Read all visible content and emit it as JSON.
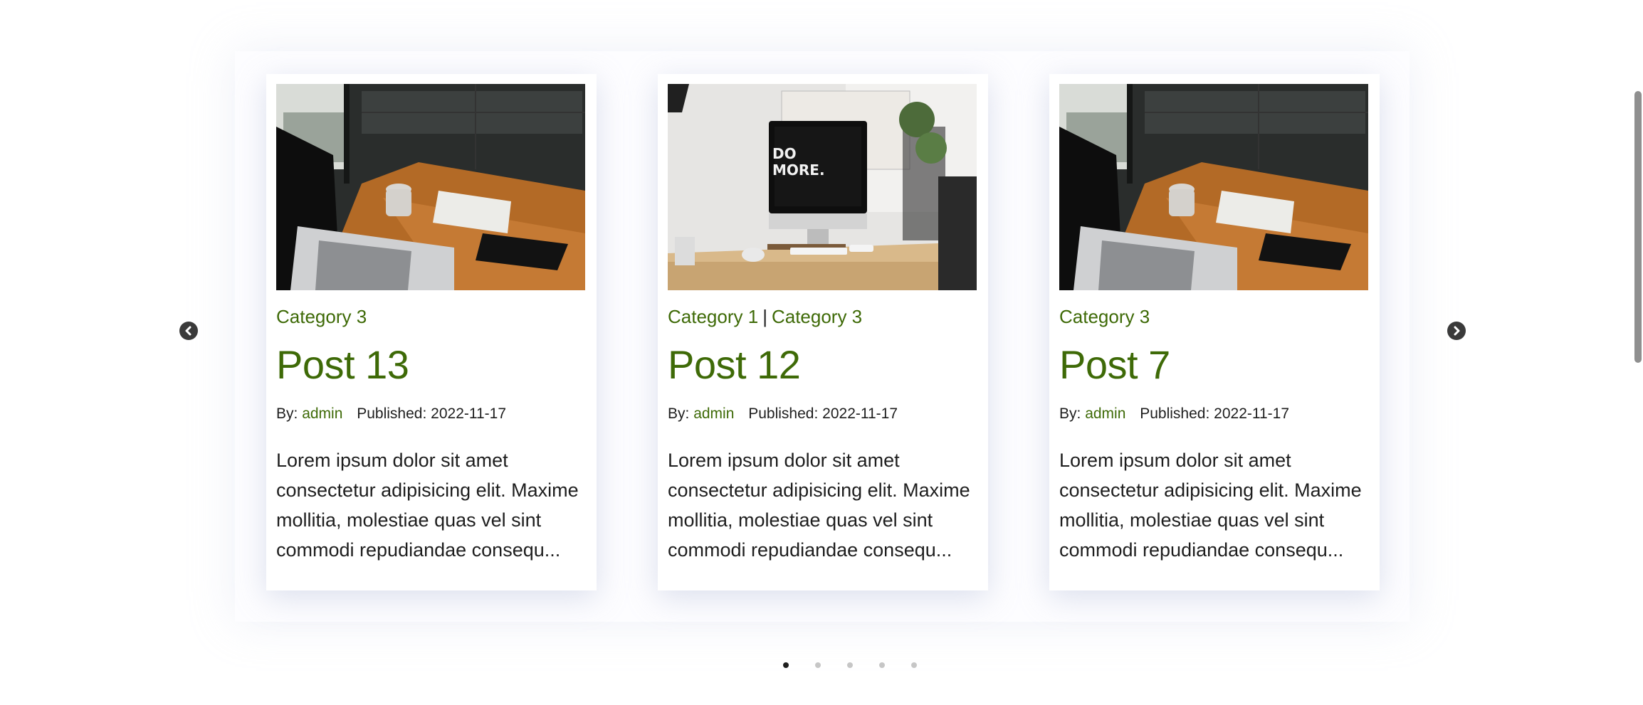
{
  "carousel": {
    "prev_icon": "chevron-left-circle-icon",
    "next_icon": "chevron-right-circle-icon",
    "posts": [
      {
        "image": "laptop-desk-photo",
        "categories": [
          "Category 3"
        ],
        "title": "Post 13",
        "by_label": "By:",
        "author": "admin",
        "published_label": "Published:",
        "published": "2022-11-17",
        "excerpt": "Lorem ipsum dolor sit amet consectetur adipisicing elit. Maxime mollitia, molestiae quas vel sint commodi repudiandae consequ..."
      },
      {
        "image": "imac-desk-photo",
        "image_text": "DO MORE.",
        "categories": [
          "Category 1",
          "Category 3"
        ],
        "category_separator": "|",
        "title": "Post 12",
        "by_label": "By:",
        "author": "admin",
        "published_label": "Published:",
        "published": "2022-11-17",
        "excerpt": "Lorem ipsum dolor sit amet consectetur adipisicing elit. Maxime mollitia, molestiae quas vel sint commodi repudiandae consequ..."
      },
      {
        "image": "laptop-desk-photo",
        "categories": [
          "Category 3"
        ],
        "title": "Post 7",
        "by_label": "By:",
        "author": "admin",
        "published_label": "Published:",
        "published": "2022-11-17",
        "excerpt": "Lorem ipsum dolor sit amet consectetur adipisicing elit. Maxime mollitia, molestiae quas vel sint commodi repudiandae consequ..."
      }
    ],
    "pagination": {
      "count": 5,
      "active_index": 0
    }
  },
  "colors": {
    "accent": "#3e6a07",
    "text": "#1e1e1e",
    "dot_inactive": "#c6c6c6",
    "arrow": "#3a3a3a"
  }
}
